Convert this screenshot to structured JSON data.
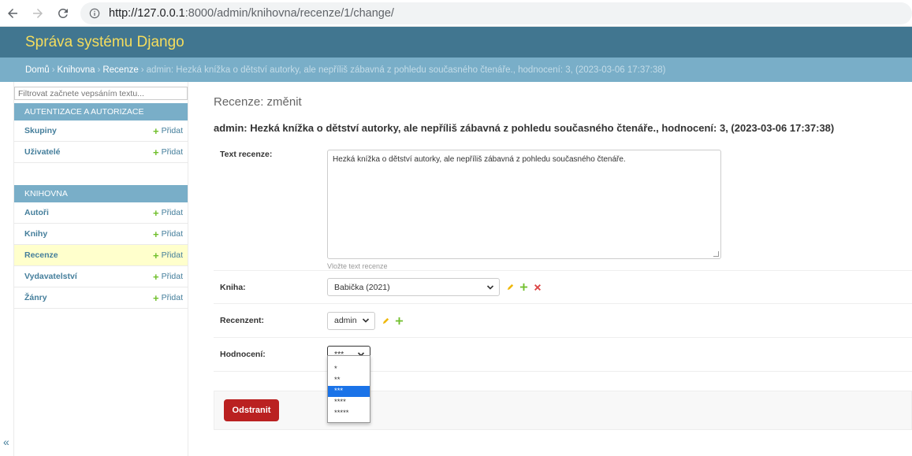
{
  "browser": {
    "url_host": "http://127.0.0.1",
    "url_path": ":8000/admin/knihovna/recenze/1/change/"
  },
  "header": {
    "brand": "Správa systému Django"
  },
  "breadcrumbs": {
    "home": "Domů",
    "app": "Knihovna",
    "model": "Recenze",
    "current": "admin: Hezká knížka o dětství autorky, ale nepříliš zábavná z pohledu současného čtenáře., hodnocení: 3, (2023-03-06 17:37:38)"
  },
  "sidebar": {
    "filter_placeholder": "Filtrovat začnete vepsáním textu...",
    "modules": [
      {
        "caption": "Autentizace a autorizace",
        "rows": [
          {
            "label": "Skupiny",
            "add": "Přidat"
          },
          {
            "label": "Uživatelé",
            "add": "Přidat"
          }
        ]
      },
      {
        "caption": "Knihovna",
        "rows": [
          {
            "label": "Autoři",
            "add": "Přidat"
          },
          {
            "label": "Knihy",
            "add": "Přidat"
          },
          {
            "label": "Recenze",
            "add": "Přidat"
          },
          {
            "label": "Vydavatelství",
            "add": "Přidat"
          },
          {
            "label": "Žánry",
            "add": "Přidat"
          }
        ]
      }
    ],
    "collapse_label": "«"
  },
  "main": {
    "page_head": "Recenze: změnit",
    "object_title": "admin: Hezká knížka o dětství autorky, ale nepříliš zábavná z pohledu současného čtenáře., hodnocení: 3, (2023-03-06 17:37:38)",
    "fields": {
      "text": {
        "label": "Text recenze:",
        "value": "Hezká knížka o dětství autorky, ale nepříliš zábavná z pohledu současného čtenáře.",
        "help": "Vložte text recenze"
      },
      "kniha": {
        "label": "Kniha:",
        "value": "Babička (2021)"
      },
      "recenzent": {
        "label": "Recenzent:",
        "value": "admin"
      },
      "hodnoceni": {
        "label": "Hodnocení:",
        "value": "***",
        "options": [
          "*",
          "**",
          "***",
          "****",
          "*****"
        ],
        "selected_index": 2
      }
    },
    "delete_button": "Odstranit"
  },
  "colors": {
    "header_bg": "#417690",
    "brand": "#f5dd5d",
    "breadcrumbs_bg": "#79aec8",
    "link": "#447e9b",
    "add_icon": "#70bf2b",
    "delete_bg": "#ba2121",
    "selected_row": "#ffffcc"
  }
}
